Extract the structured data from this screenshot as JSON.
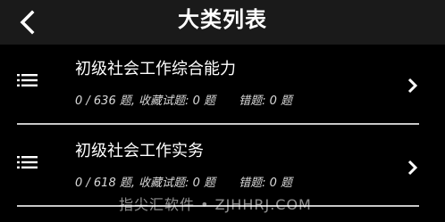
{
  "header": {
    "title": "大类列表",
    "back_icon": "chevron-left-icon"
  },
  "items": [
    {
      "title": "初级社会工作综合能力",
      "progress": "0 / 636 题,",
      "favorites": "收藏试题: 0 题",
      "wrong": "错题: 0 题"
    },
    {
      "title": "初级社会工作实务",
      "progress": "0 / 618 题,",
      "favorites": "收藏试题: 0 题",
      "wrong": "错题: 0 题"
    }
  ],
  "watermark": "指尖汇软件 • ZJHHRJ.COM",
  "colors": {
    "background": "#000000",
    "header": "#1a1a1a",
    "text": "#ffffff",
    "divider": "#c8c8c8"
  }
}
